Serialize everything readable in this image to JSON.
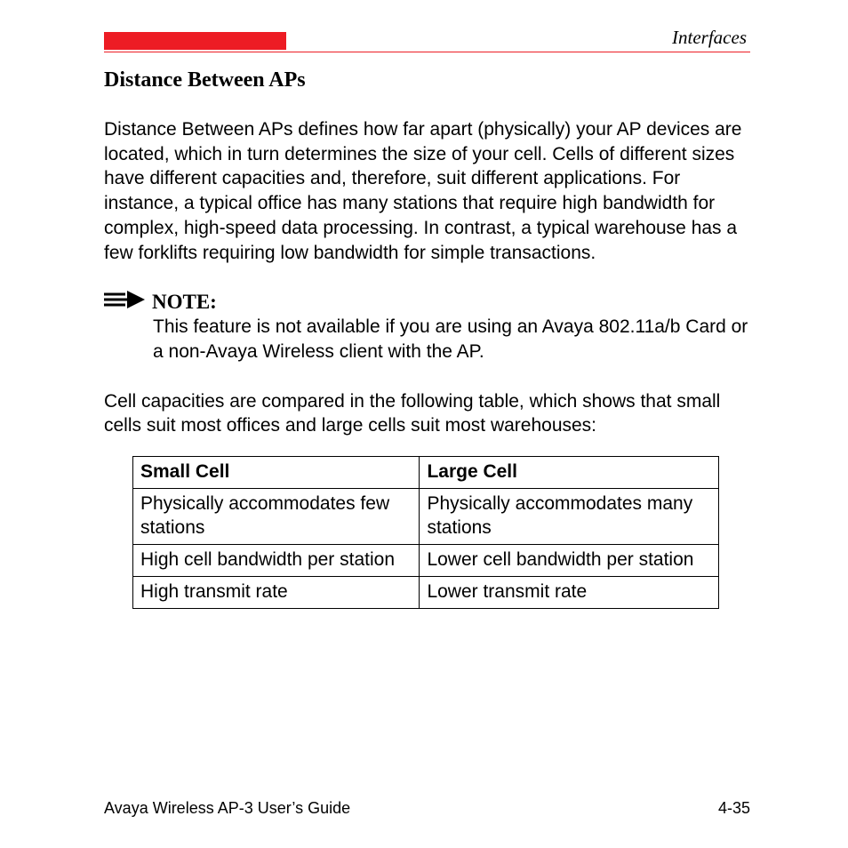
{
  "header": {
    "section": "Interfaces"
  },
  "heading": "Distance Between APs",
  "para1": "Distance Between APs defines how far apart (physically) your AP devices are located, which in turn determines the size of your cell. Cells of different sizes have different capacities and, therefore, suit different applications. For instance, a typical office has many stations that require high bandwidth for complex, high-speed data processing. In contrast, a typical warehouse has a few forklifts requiring low bandwidth for simple transactions.",
  "note": {
    "label": "NOTE:",
    "body": "This feature is not available if you are using an Avaya 802.11a/b Card or a non-Avaya Wireless client with the AP."
  },
  "para2": "Cell capacities are compared in the following table, which shows that small cells suit most offices and large cells suit most warehouses:",
  "table": {
    "headers": [
      "Small Cell",
      "Large Cell"
    ],
    "rows": [
      [
        "Physically accommodates few stations",
        "Physically accommodates many stations"
      ],
      [
        "High cell bandwidth per station",
        "Lower cell bandwidth per station"
      ],
      [
        "High transmit rate",
        "Lower transmit rate"
      ]
    ]
  },
  "footer": {
    "left": "Avaya Wireless AP-3 User’s Guide",
    "right": "4-35"
  }
}
